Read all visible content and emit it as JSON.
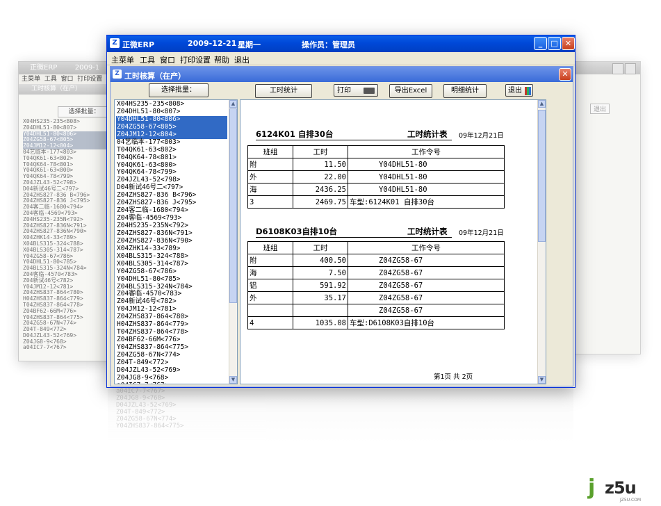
{
  "main_window": {
    "app_name": "正微ERP",
    "date": "2009-12-21",
    "weekday": "星期一",
    "operator": "操作员：管理员",
    "minimize_glyph": "_",
    "maximize_glyph": "□",
    "close_glyph": "✕"
  },
  "menu": {
    "items": [
      "主菜单",
      "工具",
      "窗口",
      "打印设置",
      "帮助",
      "退出"
    ]
  },
  "inner_window": {
    "title": "工时核算（在产）",
    "close_glyph": "✕"
  },
  "toolbar": {
    "select_batch": "选择批量：",
    "stats": "工时统计",
    "print": "打印",
    "export": "导出Excel",
    "detail": "明细统计",
    "exit": "退出"
  },
  "batch_list": {
    "items": [
      {
        "text": "X04HS235-235<808>",
        "selected": false
      },
      {
        "text": "Z04DHL51-80<807>",
        "selected": false
      },
      {
        "text": "Y04DHL51-80<806>",
        "selected": true
      },
      {
        "text": "Z04ZG58-67<805>",
        "selected": true
      },
      {
        "text": "Z04JM12-12<804>",
        "selected": true
      },
      {
        "text": "04艺临本-177<803>",
        "selected": false
      },
      {
        "text": "T04QK61-63<802>",
        "selected": false
      },
      {
        "text": "T04QK64-78<801>",
        "selected": false
      },
      {
        "text": "Y04QK61-63<800>",
        "selected": false
      },
      {
        "text": "Y04QK64-78<799>",
        "selected": false
      },
      {
        "text": "Z04JZL43-52<798>",
        "selected": false
      },
      {
        "text": "D04新试46号二<797>",
        "selected": false
      },
      {
        "text": "Z04ZHS827-836 B<796>",
        "selected": false
      },
      {
        "text": "Z04ZHS827-836 J<795>",
        "selected": false
      },
      {
        "text": "Z04客二临-1680<794>",
        "selected": false
      },
      {
        "text": "Z04客临-4569<793>",
        "selected": false
      },
      {
        "text": "Z04HS235-235N<792>",
        "selected": false
      },
      {
        "text": "Z04ZHS827-836N<791>",
        "selected": false
      },
      {
        "text": "Z04ZHS827-836N<790>",
        "selected": false
      },
      {
        "text": "X04ZHK14-33<789>",
        "selected": false
      },
      {
        "text": "X04BLS315-324<788>",
        "selected": false
      },
      {
        "text": "X04BLS305-314<787>",
        "selected": false
      },
      {
        "text": "Y04ZG58-67<786>",
        "selected": false
      },
      {
        "text": "Y04DHL51-80<785>",
        "selected": false
      },
      {
        "text": "Z04BLS315-324N<784>",
        "selected": false
      },
      {
        "text": "Z04客临-4570<783>",
        "selected": false
      },
      {
        "text": "Z04新试46号<782>",
        "selected": false
      },
      {
        "text": "Y04JM12-12<781>",
        "selected": false
      },
      {
        "text": "Z04ZHS837-864<780>",
        "selected": false
      },
      {
        "text": "H04ZHS837-864<779>",
        "selected": false
      },
      {
        "text": "T04ZHS837-864<778>",
        "selected": false
      },
      {
        "text": "Z04BF62-66M<776>",
        "selected": false
      },
      {
        "text": "Y04ZHS837-864<775>",
        "selected": false
      },
      {
        "text": "Z04ZG58-67N<774>",
        "selected": false
      },
      {
        "text": "Z04T-849<772>",
        "selected": false
      },
      {
        "text": "D04JZL43-52<769>",
        "selected": false
      },
      {
        "text": "Z04JG8-9<768>",
        "selected": false
      },
      {
        "text": "a04IC7-7<767>",
        "selected": false
      }
    ]
  },
  "report": {
    "sections": [
      {
        "title": "6124K01  自排30台",
        "kind": "工时统计表",
        "date": "09年12月21日",
        "headers": [
          "班组",
          "工时",
          "工作令号"
        ],
        "rows": [
          {
            "group": "附",
            "hours": "11.50",
            "order": "Y04DHL51-80"
          },
          {
            "group": "外",
            "hours": "22.00",
            "order": "Y04DHL51-80"
          },
          {
            "group": "海",
            "hours": "2436.25",
            "order": "Y04DHL51-80"
          }
        ],
        "total": {
          "count": "3",
          "hours": "2469.75",
          "model": "车型:6124K01  自排30台"
        }
      },
      {
        "title": "D6108K03自排10台",
        "kind": "工时统计表",
        "date": "09年12月21日",
        "headers": [
          "班组",
          "工时",
          "工作令号"
        ],
        "rows": [
          {
            "group": "附",
            "hours": "400.50",
            "order": "Z04ZG58-67"
          },
          {
            "group": "海",
            "hours": "7.50",
            "order": "Z04ZG58-67"
          },
          {
            "group": "铝",
            "hours": "591.92",
            "order": "Z04ZG58-67"
          },
          {
            "group": "外",
            "hours": "35.17",
            "order": "Z04ZG58-67"
          },
          {
            "group": "",
            "hours": "",
            "order": "Z04ZG58-67"
          }
        ],
        "total": {
          "count": "4",
          "hours": "1035.08",
          "model": "车型:D6108K03自排10台"
        }
      }
    ],
    "page_info": "第1页  共  2页"
  },
  "ghost_window": {
    "app_name": "正微ERP",
    "date_fragment": "2009-1",
    "menu": [
      "主菜单",
      "工具",
      "窗口",
      "打印设置"
    ],
    "inner_title": "工时核算（在产）",
    "select_batch": "选择批量：",
    "right_exit": "退出"
  },
  "watermark": {
    "brand_j": "j",
    "brand_rest": "z5u",
    "site": "JZ5U.COM"
  }
}
